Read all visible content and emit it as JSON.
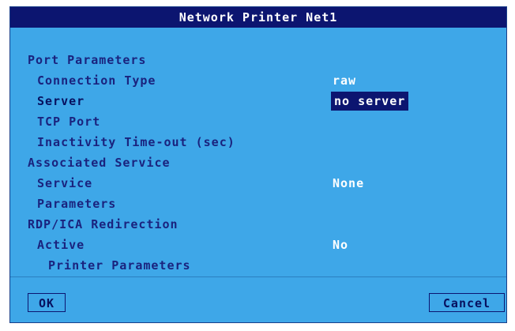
{
  "dialog": {
    "title": "Network Printer Net1"
  },
  "sections": {
    "port": {
      "heading": "Port Parameters",
      "connection_type_label": "Connection Type",
      "connection_type_value": "raw",
      "server_label": "Server",
      "server_value": "no server",
      "tcp_port_label": "TCP Port",
      "inactivity_label": "Inactivity Time-out (sec)"
    },
    "service": {
      "heading": "Associated Service",
      "service_label": "Service",
      "service_value": "None",
      "parameters_label": "Parameters"
    },
    "rdp": {
      "heading": "RDP/ICA Redirection",
      "active_label": "Active",
      "active_value": "No",
      "printer_parameters_label": "Printer Parameters"
    }
  },
  "buttons": {
    "ok_label": "OK",
    "cancel_label": "Cancel"
  },
  "colors": {
    "background": "#3ea7e8",
    "titlebar": "#0c1570",
    "label_text": "#1a237e",
    "value_text": "#ffffff",
    "highlight": "#0c1570"
  }
}
